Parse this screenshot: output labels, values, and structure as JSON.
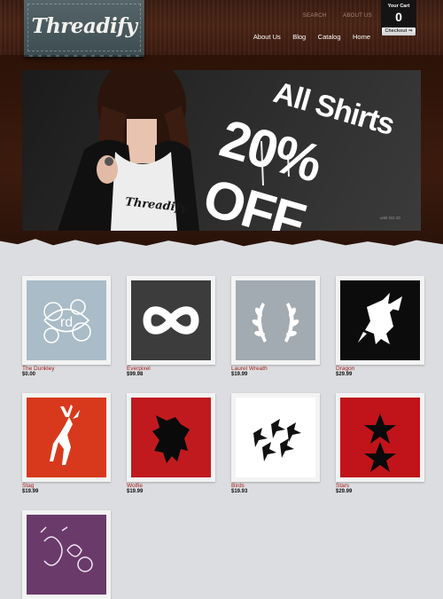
{
  "brand": {
    "logo_text": "Threadify"
  },
  "util_nav": [
    "SEARCH",
    "ABOUT US"
  ],
  "main_nav": [
    "About Us",
    "Blog",
    "Catalog",
    "Home"
  ],
  "cart": {
    "title": "Your Cart",
    "count": "0",
    "checkout_label": "Checkout ⇒"
  },
  "banner": {
    "line1": "All Shirts",
    "line2": "20% OFF",
    "shirt_logo": "Threadify",
    "fine_print": "until Oct 20"
  },
  "products": [
    {
      "name": "The Dunkley",
      "price": "$0.00",
      "icon": "floral-rd-design",
      "bg": "#a9bcc7"
    },
    {
      "name": "Everpixel",
      "price": "$99.98",
      "icon": "infinity-icon",
      "bg": "#3c3c3c"
    },
    {
      "name": "Laurel Wreath",
      "price": "$19.99",
      "icon": "laurel-wreath-icon",
      "bg": "#a2aab2"
    },
    {
      "name": "Dragon",
      "price": "$29.99",
      "icon": "griffin-icon",
      "bg": "#0c0c0c"
    },
    {
      "name": "Stag",
      "price": "$19.99",
      "icon": "stag-icon",
      "bg": "#d8391d"
    },
    {
      "name": "Wolfie",
      "price": "$19.99",
      "icon": "wolf-icon",
      "bg": "#c01a1e"
    },
    {
      "name": "Birds",
      "price": "$19.93",
      "icon": "birds-icon",
      "bg": "#ffffff"
    },
    {
      "name": "Stars",
      "price": "$29.99",
      "icon": "stars-icon",
      "bg": "#c0141a"
    },
    {
      "name": "",
      "price": "",
      "icon": "doodle-design",
      "bg": "#6a3a6a"
    }
  ]
}
